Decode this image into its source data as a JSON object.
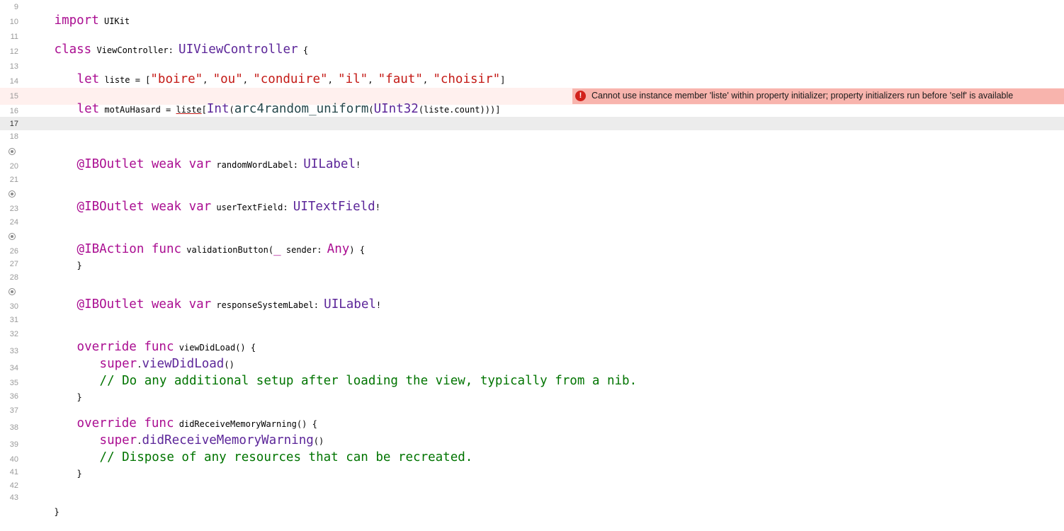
{
  "line_numbers": [
    "9",
    "10",
    "11",
    "12",
    "13",
    "14",
    "15",
    "16",
    "17",
    "18",
    "20",
    "21",
    "23",
    "24",
    "26",
    "27",
    "28",
    "30",
    "31",
    "32",
    "33",
    "34",
    "35",
    "36",
    "37",
    "38",
    "39",
    "40",
    "41",
    "42",
    "43"
  ],
  "code": {
    "l9": {
      "import_kw": "import",
      "module": " UIKit"
    },
    "l11": {
      "class_kw": "class",
      "name": " ViewController",
      "colon": ": ",
      "super": "UIViewController",
      "brace": " {"
    },
    "l13": {
      "let_kw": "let",
      "name": " liste = [",
      "s1": "\"boire\"",
      "c1": ", ",
      "s2": "\"ou\"",
      "c2": ", ",
      "s3": "\"conduire\"",
      "c3": ", ",
      "s4": "\"il\"",
      "c4": ", ",
      "s5": "\"faut\"",
      "c5": ", ",
      "s6": "\"choisir\"",
      "end": "]"
    },
    "l15": {
      "let_kw": "let",
      "name": " motAuHasard = ",
      "liste": "liste",
      "open": "[",
      "int": "Int",
      "p1": "(",
      "arc": "arc4random_uniform",
      "p2": "(",
      "uint": "UInt32",
      "p3": "(",
      "count": "liste.count",
      "close": ")))]"
    },
    "l19": {
      "attr": "@IBOutlet",
      "weak": " weak",
      "var": " var",
      "name": " randomWordLabel: ",
      "type": "UILabel",
      "bang": "!"
    },
    "l22": {
      "attr": "@IBOutlet",
      "weak": " weak",
      "var": " var",
      "name": " userTextField: ",
      "type": "UITextField",
      "bang": "!"
    },
    "l25": {
      "attr": "@IBAction",
      "func": " func",
      "name": " validationButton(",
      "us": "_",
      "sender": " sender: ",
      "any": "Any",
      "end": ") {"
    },
    "l26": {
      "brace": "}"
    },
    "l29": {
      "attr": "@IBOutlet",
      "weak": " weak",
      "var": " var",
      "name": " responseSystemLabel: ",
      "type": "UILabel",
      "bang": "!"
    },
    "l32": {
      "override": "override",
      "func": " func",
      "name": " viewDidLoad() {"
    },
    "l33": {
      "super": "super",
      "dot": ".",
      "method": "viewDidLoad",
      "parens": "()"
    },
    "l34": {
      "comment": "// Do any additional setup after loading the view, typically from a nib."
    },
    "l35": {
      "brace": "}"
    },
    "l37": {
      "override": "override",
      "func": " func",
      "name": " didReceiveMemoryWarning() {"
    },
    "l38": {
      "super": "super",
      "dot": ".",
      "method": "didReceiveMemoryWarning",
      "parens": "()"
    },
    "l39": {
      "comment": "// Dispose of any resources that can be recreated."
    },
    "l40": {
      "brace": "}"
    },
    "l43": {
      "brace": "}"
    }
  },
  "error": {
    "icon": "!",
    "message": "Cannot use instance member 'liste' within property initializer; property initializers run before 'self' is available"
  },
  "colors": {
    "keyword": "#aa0d91",
    "type": "#5c2699",
    "string": "#c41a16",
    "comment": "#007400",
    "error_banner": "#f8b4ad",
    "error_line": "#fff0ee",
    "current_line": "#ececec"
  },
  "icons": {
    "outlet_connection": "outlet-connected-icon",
    "error": "error-icon"
  }
}
